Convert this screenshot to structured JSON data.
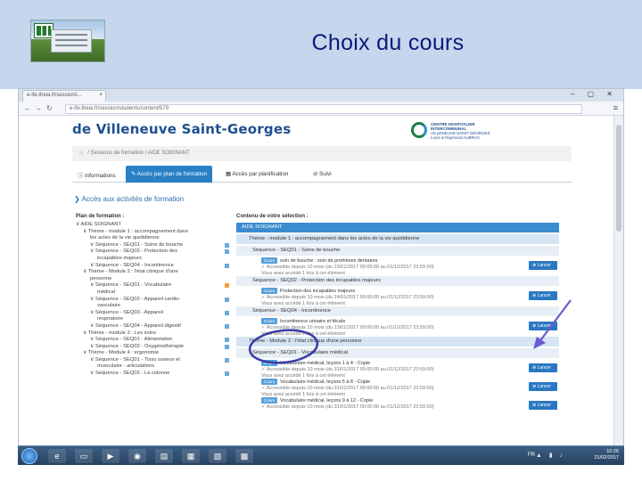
{
  "slide": {
    "title": "Choix du cours"
  },
  "browser": {
    "tab_title": "e-ife.theia.fr/session/i...",
    "tab_close": "×",
    "window_controls": "– ▢ ✕",
    "url": "e-ife.theia.fr/session/students/content/579"
  },
  "site": {
    "title": "de Villeneuve Saint-Georges",
    "logo_lines": [
      "CENTRE HOSPITALIER",
      "INTERCOMMUNAL",
      "VILLENEUVE-SAINT-GEORGES",
      "Lucie & Raymond AUBRAC"
    ]
  },
  "breadcrumb": {
    "home_icon": "home-icon",
    "text": "/  Sessions de formation  /  AIDE SOIGNANT"
  },
  "tabs": [
    {
      "label": "ⓘ Informations"
    },
    {
      "label": "✎ Accès par plan de formation"
    },
    {
      "label": "▦ Accès par planification"
    },
    {
      "label": "⊘ Suivi"
    }
  ],
  "access_title": "❯ Accès aux activités de formation",
  "left": {
    "title": "Plan de formation :",
    "tree": [
      {
        "text": "∨  AIDE SOIGNANT",
        "indent": 0
      },
      {
        "text": "∨  Thème - module 1 : accompagnement dans",
        "indent": 1
      },
      {
        "text": "les actes de la vie quotidienne",
        "indent": 2
      },
      {
        "text": "∨  Séquence - SEQ01 - Soins de bouche",
        "indent": 2,
        "marker": "blue"
      },
      {
        "text": "∨  Séquence - SEQ02 - Protection des",
        "indent": 2,
        "marker": "blue"
      },
      {
        "text": "incapables majeurs",
        "indent": 3
      },
      {
        "text": "∨  Séquence - SEQ04 - Incontinence",
        "indent": 2,
        "marker": "blue"
      },
      {
        "text": "∨  Thème - Module 2 : l'état clinique d'une",
        "indent": 1
      },
      {
        "text": "personne",
        "indent": 2
      },
      {
        "text": "∨  Séquence - SEQ01 - Vocabulaire",
        "indent": 2,
        "marker": "orange"
      },
      {
        "text": "médical",
        "indent": 3
      },
      {
        "text": "∨  Séquence - SEQ02 - Appareil cardio-",
        "indent": 2,
        "marker": "blue"
      },
      {
        "text": "vasculaire",
        "indent": 3
      },
      {
        "text": "∨  Séquence - SEQ03 - Appareil",
        "indent": 2,
        "marker": "blue"
      },
      {
        "text": "respiratoire",
        "indent": 3
      },
      {
        "text": "∨  Séquence - SEQ04 - Appareil digestif",
        "indent": 2,
        "marker": "blue"
      },
      {
        "text": "∨  Thème - module 3 : Les soins",
        "indent": 1
      },
      {
        "text": "∨  Séquence - SEQ01 - Alimentation",
        "indent": 2,
        "marker": "blue"
      },
      {
        "text": "∨  Séquence - SEQ02 - Oxygénothérapie",
        "indent": 2,
        "marker": "blue"
      },
      {
        "text": "∨  Thème - Module 4 : ergonomie",
        "indent": 1
      },
      {
        "text": "∨  Séquence - SEQ01 - Tissu osseux et",
        "indent": 2,
        "marker": "blue"
      },
      {
        "text": "musculaire - articulations",
        "indent": 3
      },
      {
        "text": "∨  Séquence - SEQ02 - La colonne",
        "indent": 2,
        "marker": "blue"
      }
    ]
  },
  "right": {
    "title": "Contenu de votre sélection :",
    "header": "AIDE SOIGNANT",
    "rows": [
      {
        "kind": "mod",
        "text": "Thème - module 1 : accompagnement dans les actes de la vie quotidienne"
      },
      {
        "kind": "seq",
        "text": "Séquence - SEQ01 - Soins de bouche"
      },
      {
        "kind": "item",
        "badge": "Cours",
        "title": "soin de bouche : soin de prothèses dentaires",
        "l2": "✓ Accessible depuis 10 mois (du 23/01/2017 00:00:00 au 01/12/2017 23:59:00)",
        "l3": "Vous avez accédé 1 fois à cet élément",
        "launch": "⊕ Lancer"
      },
      {
        "kind": "seq",
        "text": "Séquence - SEQ02 - Protection des incapables majeurs"
      },
      {
        "kind": "item",
        "badge": "Cours",
        "title": "Protection des incapables majeurs",
        "l2": "✓ Accessible depuis 10 mois (du 24/01/2017 00:00:00 au 01/12/2017 23:59:00)",
        "l3": "Vous avez accédé 1 fois à cet élément",
        "launch": "⊕ Lancer"
      },
      {
        "kind": "seq",
        "text": "Séquence - SEQ04 - Incontinence"
      },
      {
        "kind": "item",
        "badge": "Cours",
        "title": "Incontinence urinaire et fécale",
        "l2": "✓ Accessible depuis 10 mois (du 13/01/2017 00:00:00 au 01/12/2017 23:59:00)",
        "l3": "Vous avez accédé 2 fois à cet élément",
        "launch": "⊕ Lancer"
      },
      {
        "kind": "mod",
        "text": "Thème - Module 2 : l'état clinique d'une personne"
      },
      {
        "kind": "seq",
        "text": "Séquence - SEQ01 - Vocabulaire médical"
      },
      {
        "kind": "item",
        "badge": "Cours",
        "title": "Vocabulaire médical, leçons 1 à 4 - Copie",
        "l2": "✓ Accessible depuis 10 mois (du 31/01/2017 00:00:00 au 01/12/2017 23:59:00)",
        "l3": "Vous avez accédé 1 fois à cet élément",
        "launch": "⊕ Lancer"
      },
      {
        "kind": "item",
        "badge": "Cours",
        "title": "Vocabulaire médical, leçons 5 à 8 - Copie",
        "l2": "✓ Accessible depuis 10 mois (du 31/01/2017 00:00:00 au 01/12/2017 23:59:00)",
        "l3": "Vous avez accédé 1 fois à cet élément",
        "launch": "⊕ Lancer"
      },
      {
        "kind": "item",
        "badge": "Cours",
        "title": "Vocabulaire médical, leçons 9 à 12 - Copie",
        "l2": "✓ Accessible depuis 10 mois (du 31/01/2017 00:00:00 au 01/12/2017 23:59:00)",
        "l3": "",
        "launch": "⊕ Lancer"
      }
    ]
  },
  "taskbar": {
    "apps": [
      "e",
      "▭",
      "▶",
      "◉",
      "▤",
      "▦",
      "▧",
      "▩"
    ],
    "lang": "FR",
    "time": "10:26",
    "date": "21/02/2017"
  },
  "colors": {
    "header_band": "#c6d6ec",
    "slide_title": "#0a1a7a",
    "accent": "#2a80c5",
    "annotation": "#3a3aa8"
  }
}
